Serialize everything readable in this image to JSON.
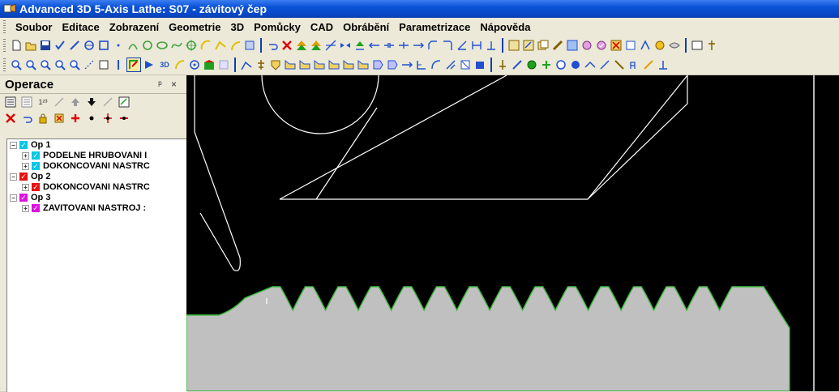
{
  "window": {
    "title": "Advanced 3D 5-Axis Lathe: S07 - závitový čep"
  },
  "menu": [
    {
      "label": "Soubor"
    },
    {
      "label": "Editace"
    },
    {
      "label": "Zobrazení"
    },
    {
      "label": "Geometrie"
    },
    {
      "label": "3D"
    },
    {
      "label": "Pomůcky"
    },
    {
      "label": "CAD"
    },
    {
      "label": "Obrábění"
    },
    {
      "label": "Parametrizace"
    },
    {
      "label": "Nápověda"
    }
  ],
  "panel": {
    "title": "Operace",
    "controls": "ᵖ ×",
    "tree": [
      {
        "label": "Op 1",
        "level": 1,
        "check_color": "#00c8e8",
        "expander": "−"
      },
      {
        "label": "PODELNE HRUBOVANI  I",
        "level": 2,
        "check_color": "#00c8e8",
        "expander": "+"
      },
      {
        "label": "DOKONCOVANI  NASTRC",
        "level": 2,
        "check_color": "#00c8e8",
        "expander": "+"
      },
      {
        "label": "Op 2",
        "level": 1,
        "check_color": "#e81010",
        "expander": "−"
      },
      {
        "label": "DOKONCOVANI  NASTRC",
        "level": 2,
        "check_color": "#e81010",
        "expander": "+"
      },
      {
        "label": "Op 3",
        "level": 1,
        "check_color": "#e010e0",
        "expander": "−"
      },
      {
        "label": "ZAVITOVANI  NASTROJ :",
        "level": 2,
        "check_color": "#e010e0",
        "expander": "+"
      }
    ]
  },
  "colors": {
    "titlebar": "#0a52d6",
    "viewport_bg": "#000000",
    "part_fill": "#c0c0c0",
    "part_edge": "#38b838",
    "wire": "#ffffff"
  },
  "toolbar_icons": [
    "new-icon",
    "open-icon",
    "save-icon",
    "zoom-icon",
    "3d-view-icon",
    "delete-icon",
    "cad-icon"
  ]
}
